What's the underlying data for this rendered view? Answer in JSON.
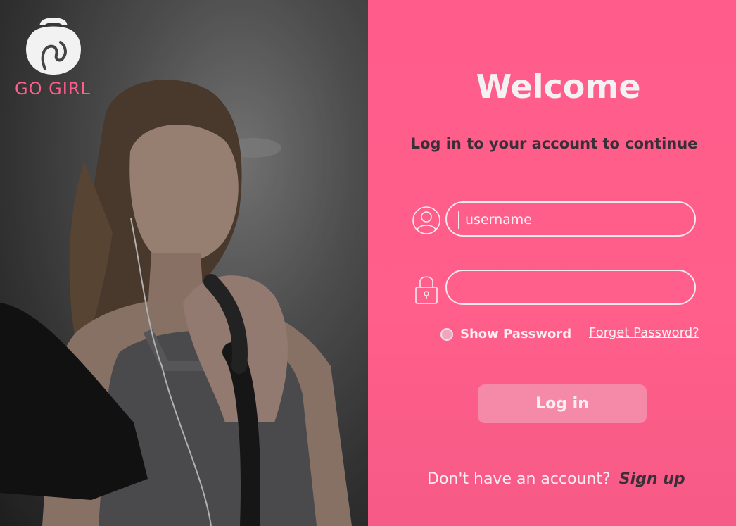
{
  "brand": {
    "name": "GO GIRL",
    "accent_color": "#ff5d8c"
  },
  "hero": {
    "icon": "woman-exercising-photo"
  },
  "login": {
    "title": "Welcome",
    "subtitle": "Log in to your account to continue",
    "username": {
      "icon": "user-icon",
      "placeholder": "username",
      "value": ""
    },
    "password": {
      "icon": "lock-icon",
      "placeholder": "",
      "value": ""
    },
    "show_password_label": "Show Password",
    "show_password_checked": false,
    "forget_password_label": "Forget Password?",
    "login_button_label": "Log in",
    "signup_prompt": "Don't have an account?",
    "signup_link_label": "Sign up",
    "panel_color": "#ff5c8b",
    "button_color": "#f58aa8"
  }
}
